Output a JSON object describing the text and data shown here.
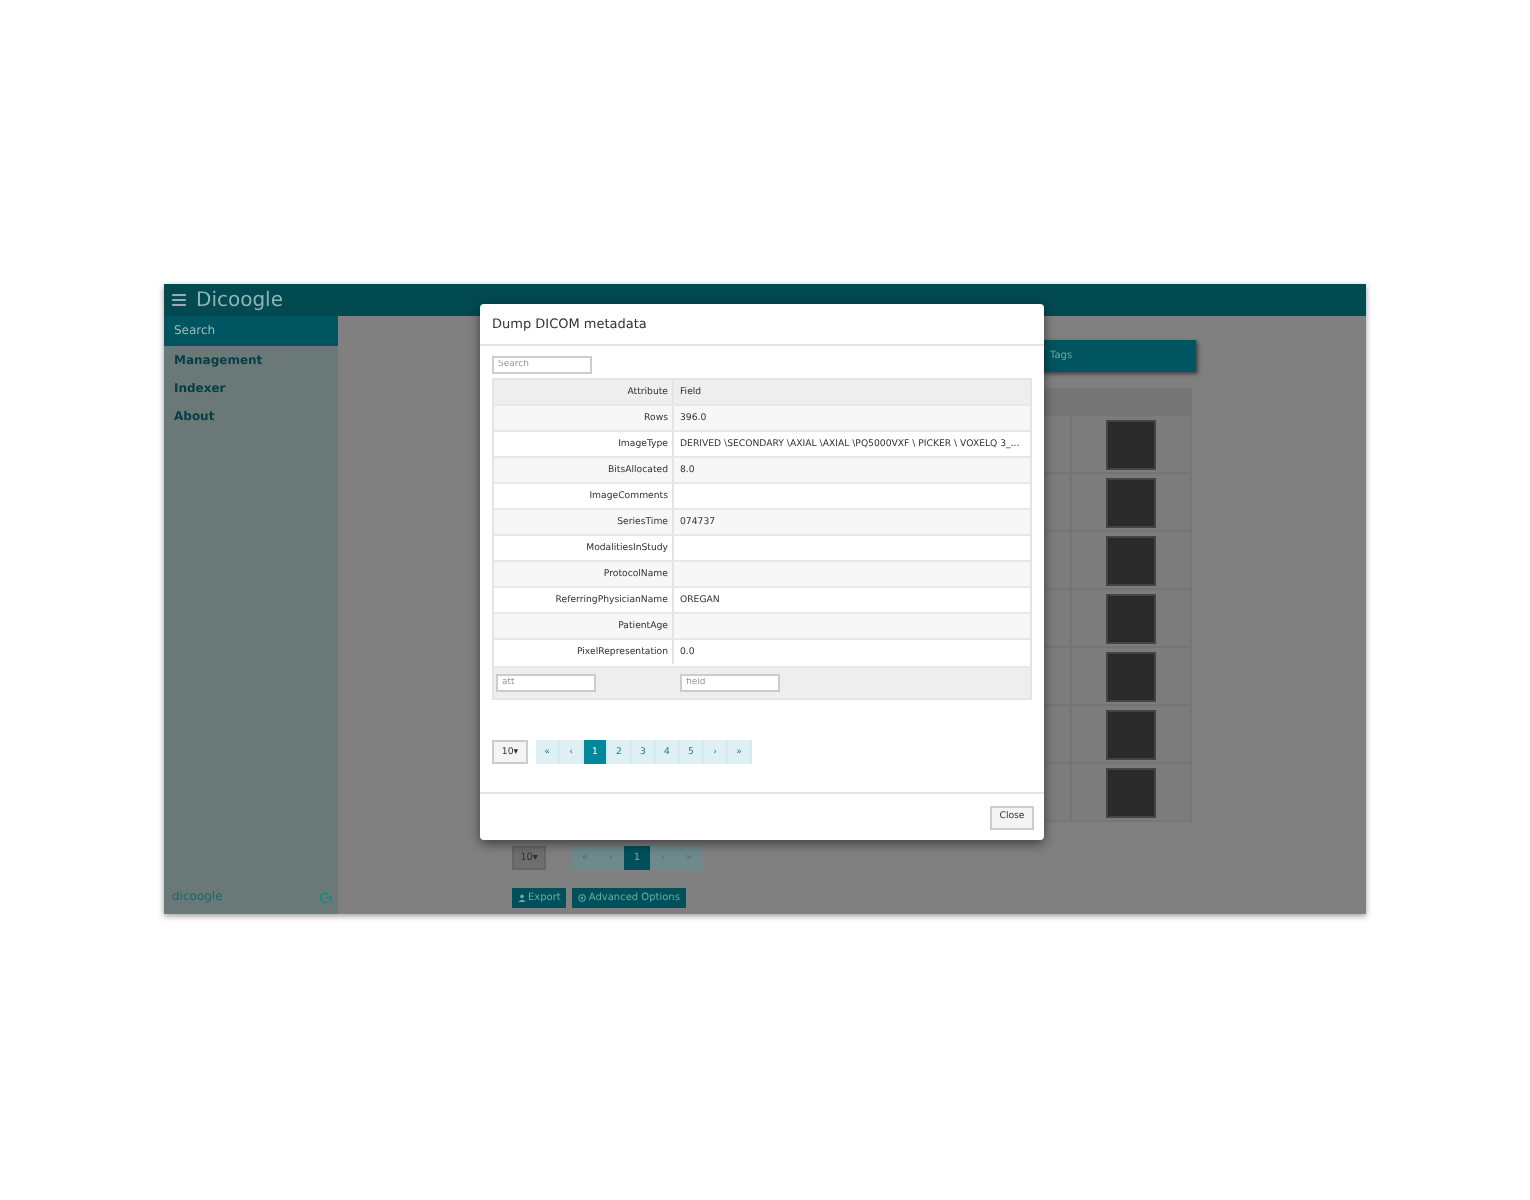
{
  "app": {
    "title": "Dicoogle",
    "menu": [
      {
        "label": "Search",
        "selected": true
      },
      {
        "label": "Management",
        "selected": false
      },
      {
        "label": "Indexer",
        "selected": false
      },
      {
        "label": "About",
        "selected": false
      }
    ],
    "footer": "dicoogle"
  },
  "results": {
    "tags_button": "Tags",
    "rows": [
      {
        "kind": "image"
      },
      {
        "kind": "image"
      },
      {
        "kind": "image"
      },
      {
        "kind": "image"
      },
      {
        "kind": "image"
      },
      {
        "kind": "image"
      },
      {
        "kind": "image"
      }
    ],
    "page_size": "10▾",
    "pages": [
      {
        "label": "«",
        "selected": false
      },
      {
        "label": "‹",
        "selected": false
      },
      {
        "label": "1",
        "selected": true
      },
      {
        "label": "›",
        "selected": false
      },
      {
        "label": "»",
        "selected": false
      }
    ],
    "export_button": "Export",
    "advanced_button": "Advanced Options"
  },
  "modal": {
    "title": "Dump DICOM metadata",
    "search": {
      "placeholder": "Search"
    },
    "columns": [
      "Attribute",
      "Field"
    ],
    "rows": [
      {
        "attribute": "Rows",
        "field": "396.0"
      },
      {
        "attribute": "ImageType",
        "field": "DERIVED \\SECONDARY \\AXIAL \\AXIAL \\PQ5000VXF \\ PICKER \\ VOXELQ 3_..."
      },
      {
        "attribute": "BitsAllocated",
        "field": "8.0"
      },
      {
        "attribute": "ImageComments",
        "field": ""
      },
      {
        "attribute": "SeriesTime",
        "field": "074737"
      },
      {
        "attribute": "ModalitiesInStudy",
        "field": ""
      },
      {
        "attribute": "ProtocolName",
        "field": ""
      },
      {
        "attribute": "ReferringPhysicianName",
        "field": "OREGAN"
      },
      {
        "attribute": "PatientAge",
        "field": ""
      },
      {
        "attribute": "PixelRepresentation",
        "field": "0.0"
      }
    ],
    "filters": [
      {
        "placeholder": "att"
      },
      {
        "placeholder": "field"
      }
    ],
    "page_size": "10▾",
    "pages": [
      {
        "label": "«",
        "selected": false
      },
      {
        "label": "‹",
        "selected": false
      },
      {
        "label": "1",
        "selected": true
      },
      {
        "label": "2",
        "selected": false
      },
      {
        "label": "3",
        "selected": false
      },
      {
        "label": "4",
        "selected": false
      },
      {
        "label": "5",
        "selected": false
      },
      {
        "label": "›",
        "selected": false
      },
      {
        "label": "»",
        "selected": false
      }
    ],
    "close_button": "Close"
  }
}
